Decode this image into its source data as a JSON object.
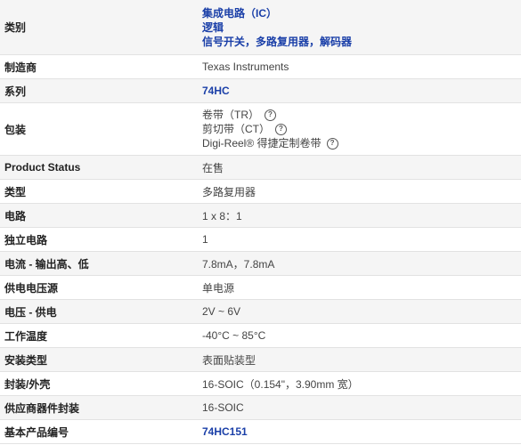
{
  "rows": {
    "category": {
      "label": "类别",
      "values": [
        "集成电路（IC）",
        "逻辑",
        "信号开关，多路复用器，解码器"
      ]
    },
    "manufacturer": {
      "label": "制造商",
      "value": "Texas Instruments"
    },
    "series": {
      "label": "系列",
      "value": "74HC"
    },
    "packaging": {
      "label": "包装",
      "values": [
        "卷带（TR）",
        "剪切带（CT）",
        "Digi-Reel® 得捷定制卷带"
      ],
      "help_icon": "question-circle-icon"
    },
    "product_status": {
      "label": "Product Status",
      "value": "在售"
    },
    "type": {
      "label": "类型",
      "value": "多路复用器"
    },
    "circuit": {
      "label": "电路",
      "value": "1 x 8：1"
    },
    "independent_circuits": {
      "label": "独立电路",
      "value": "1"
    },
    "current_output": {
      "label": "电流 - 输出高、低",
      "value": "7.8mA，7.8mA"
    },
    "supply_source": {
      "label": "供电电压源",
      "value": "单电源"
    },
    "voltage_supply": {
      "label": "电压 - 供电",
      "value": "2V ~ 6V"
    },
    "operating_temp": {
      "label": "工作温度",
      "value": "-40°C ~ 85°C"
    },
    "mounting_type": {
      "label": "安装类型",
      "value": "表面贴装型"
    },
    "package_case": {
      "label": "封装/外壳",
      "value": "16-SOIC（0.154\"，3.90mm 宽）"
    },
    "supplier_package": {
      "label": "供应商器件封装",
      "value": "16-SOIC"
    },
    "base_product": {
      "label": "基本产品编号",
      "value": "74HC151"
    }
  },
  "colors": {
    "link": "#1a3fa8",
    "stripe": "#f5f5f5",
    "border": "#e2e2e2"
  }
}
